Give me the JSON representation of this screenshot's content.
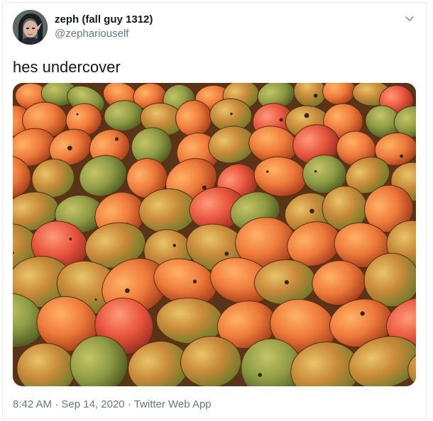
{
  "author": {
    "display_name": "zeph (fall guy 1312)",
    "handle": "@zephariouself"
  },
  "tweet": {
    "text": "hes undercover"
  },
  "media": {
    "description_icon": "photo-of-mangoes"
  },
  "meta": {
    "time": "8:42 AM",
    "separator1": " · ",
    "date": "Sep 14, 2020",
    "separator2": " · ",
    "source": "Twitter Web App"
  },
  "icons": {
    "menu": "chevron-down-icon"
  },
  "colors": {
    "text": "#14171a",
    "secondary": "#657786",
    "border": "#e6ecf0"
  }
}
